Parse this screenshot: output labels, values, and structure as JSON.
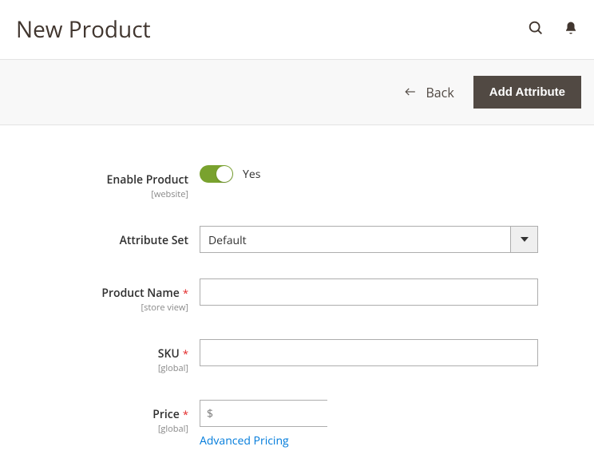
{
  "header": {
    "title": "New Product"
  },
  "toolbar": {
    "back_label": "Back",
    "add_attribute_label": "Add Attribute"
  },
  "form": {
    "enable_product": {
      "label": "Enable Product",
      "scope": "[website]",
      "value_label": "Yes"
    },
    "attribute_set": {
      "label": "Attribute Set",
      "value": "Default"
    },
    "product_name": {
      "label": "Product Name",
      "scope": "[store view]",
      "value": ""
    },
    "sku": {
      "label": "SKU",
      "scope": "[global]",
      "value": ""
    },
    "price": {
      "label": "Price",
      "scope": "[global]",
      "currency": "$",
      "value": "",
      "advanced_link": "Advanced Pricing"
    }
  }
}
